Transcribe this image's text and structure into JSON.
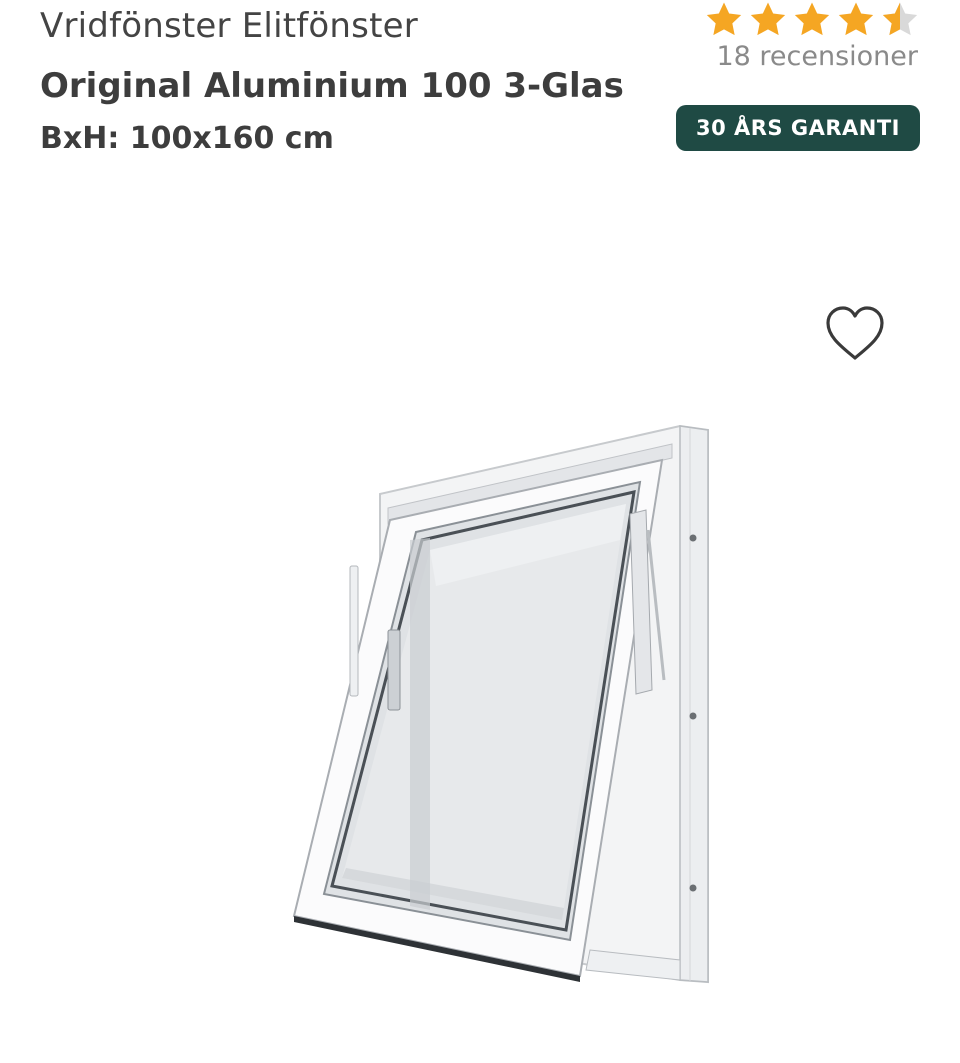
{
  "product": {
    "category": "Vridfönster Elitfönster",
    "title": "Original Aluminium 100 3-Glas",
    "dimensions": "BxH: 100x160 cm"
  },
  "rating": {
    "stars": 4.5,
    "max_stars": 5,
    "review_count": "18 recensioner",
    "star_color": "#f5a623",
    "empty_star_color": "#d9d9d9"
  },
  "badge": {
    "label": "30 ÅRS GARANTI",
    "color": "#1f4a44"
  },
  "icons": {
    "favorite": "heart-outline-icon"
  }
}
